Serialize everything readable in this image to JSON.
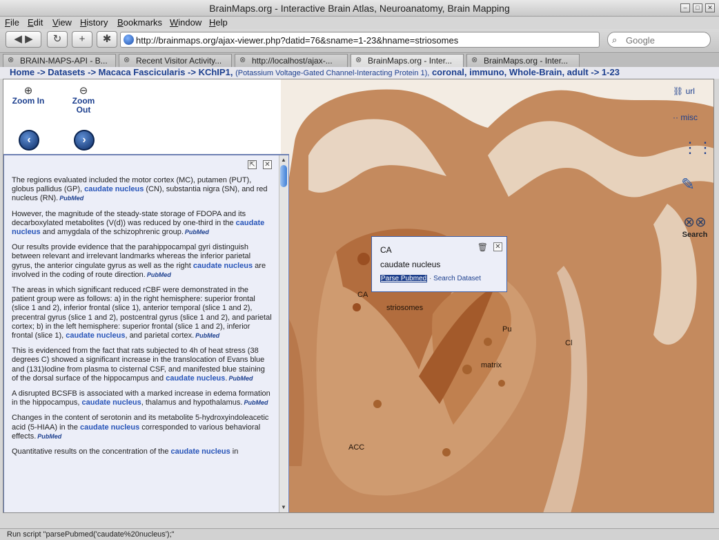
{
  "window": {
    "title": "BrainMaps.org - Interactive Brain Atlas, Neuroanatomy, Brain Mapping"
  },
  "menu": [
    "File",
    "Edit",
    "View",
    "History",
    "Bookmarks",
    "Window",
    "Help"
  ],
  "nav": {
    "url": "http://brainmaps.org/ajax-viewer.php?datid=76&sname=1-23&hname=striosomes",
    "search_placeholder": "Google"
  },
  "tabs": [
    {
      "label": "BRAIN-MAPS-API - B..."
    },
    {
      "label": "Recent Visitor Activity..."
    },
    {
      "label": "http://localhost/ajax-..."
    },
    {
      "label": "BrainMaps.org - Inter..."
    },
    {
      "label": "BrainMaps.org - Inter..."
    }
  ],
  "breadcrumb": {
    "home": "Home",
    "sep": "->",
    "datasets": "Datasets",
    "species": "Macaca Fascicularis",
    "stain": "KChIP1,",
    "stain_full": "(Potassium Voltage-Gated Channel-Interacting Protein 1),",
    "details": "coronal, immuno, Whole-Brain, adult",
    "section": "1-23"
  },
  "viewer": {
    "zoom_in": "Zoom In",
    "zoom_out": "Zoom Out",
    "url_link": "url",
    "misc_link": "misc",
    "search_label": "Search"
  },
  "panel": {
    "keyword": "caudate nucleus",
    "pubmed": "PubMed",
    "paragraphs": [
      [
        "The regions evaluated included the motor cortex (MC), putamen (PUT), globus pallidus (GP), ",
        "caudate nucleus",
        " (CN), substantia nigra (SN), and red nucleus (RN)."
      ],
      [
        "However, the magnitude of the steady-state storage of FDOPA and its decarboxylated metabolites (V(d)) was reduced by one-third in the ",
        "caudate nucleus",
        " and amygdala of the schizophrenic group."
      ],
      [
        "Our results provide evidence that the parahippocampal gyri distinguish between relevant and irrelevant landmarks whereas the inferior parietal gyrus, the anterior cingulate gyrus as well as the right ",
        "caudate nucleus",
        " are involved in the coding of route direction."
      ],
      [
        "The areas in which significant reduced rCBF were demonstrated in the patient group were as follows: a) in the right hemisphere: superior frontal (slice 1 and 2), inferior frontal (slice 1), anterior temporal (slice 1 and 2), precentral gyrus (slice 1 and 2), postcentral gyrus (slice 1 and 2), and parietal cortex; b) in the left hemisphere: superior frontal (slice 1 and 2), inferior frontal (slice 1), ",
        "caudate nucleus",
        ", and parietal cortex."
      ],
      [
        "This is evidenced from the fact that rats subjected to 4h of heat stress (38 degrees C) showed a significant increase in the translocation of Evans blue and (131)Iodine from plasma to cisternal CSF, and manifested blue staining of the dorsal surface of the hippocampus and ",
        "caudate nucleus",
        "."
      ],
      [
        "A disrupted BCSFB is associated with a marked increase in edema formation in the hippocampus, ",
        "caudate nucleus",
        ", thalamus and hypothalamus."
      ],
      [
        "Changes in the content of serotonin and its metabolite 5-hydroxyindoleacetic acid (5-HIAA) in the ",
        "caudate nucleus",
        " corresponded to various behavioral effects."
      ],
      [
        "Quantitative results on the concentration of the ",
        "caudate nucleus",
        " in"
      ]
    ]
  },
  "popup": {
    "abbr": "CA",
    "name": "caudate nucleus",
    "parse_link": "Parse Pubmed",
    "sep": "·",
    "search_link": "Search Dataset"
  },
  "labels": {
    "ca": "CA",
    "striosomes": "striosomes",
    "pu": "Pu",
    "cl": "Cl",
    "matrix": "matrix",
    "acc": "ACC"
  },
  "status": "Run script \"parsePubmed('caudate%20nucleus');\"",
  "colors": {
    "link": "#1c3f8e",
    "keyword": "#2754b8",
    "tissue": "#c98c5c"
  }
}
